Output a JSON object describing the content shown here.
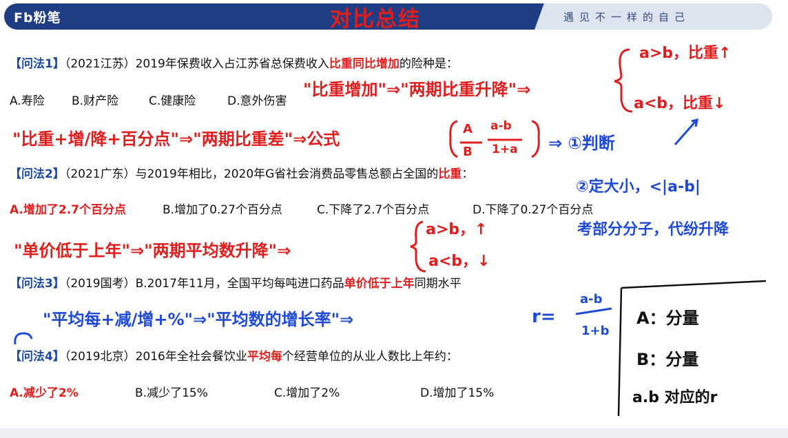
{
  "header": {
    "logo": "Fb粉笔",
    "title": "对比总结",
    "slogan": "遇见不一样的自己"
  },
  "questions": [
    {
      "tag": "【问法1】",
      "source": "（2021江苏）",
      "text_pre": "2019年保费收入占江苏省总保费收入",
      "text_em": "比重同比增加",
      "text_post": "的险种是：",
      "options": [
        "A.寿险",
        "B.财产险",
        "C.健康险",
        "D.意外伤害"
      ]
    },
    {
      "tag": "【问法2】",
      "source": "（2021广东）",
      "text_pre": "与2019年相比，2020年G省社会消费品零售总额占全国的",
      "text_em": "比重",
      "text_post": "：",
      "options": [
        "A.增加了2.7个百分点",
        "B.增加了0.27个百分点",
        "C.下降了2.7个百分点",
        "D.下降了0.27个百分点"
      ]
    },
    {
      "tag": "【问法3】",
      "source": "（2019国考）",
      "text_pre": "B.2017年11月，全国平均每吨进口药品",
      "text_em": "单价低于上年",
      "text_post": "同期水平"
    },
    {
      "tag": "【问法4】",
      "source": "（2019北京）",
      "text_pre": "2016年全社会餐饮业",
      "text_em": "平均每",
      "text_post": "个经营单位的从业人数比上年约：",
      "options": [
        "A.减少了2%",
        "B.减少了15%",
        "C.增加了2%",
        "D.增加了15%"
      ]
    }
  ],
  "annotations": {
    "red_1": "\"比重增加\"⇒\"两期比重升降\"⇒",
    "red_brace_top": "a>b，比重↑",
    "red_brace_bottom": "a<b，比重↓",
    "red_2": "\"比重+增/降+百分点\"⇒\"两期比重差\"⇒公式",
    "red_formula_num1": "A",
    "red_formula_den1": "B",
    "red_formula_num2": "a-b",
    "red_formula_den2": "1+a",
    "blue_1": "⇒ ①判断",
    "blue_2": "②定大小，<|a-b|",
    "blue_3": "考部分分子，代纷升降",
    "red_3": "\"单价低于上年\"⇒\"两期平均数升降\"⇒",
    "red_brace2_top": "a>b，↑",
    "red_brace2_bottom": "a<b，↓",
    "blue_4": "\"平均每+减/增+%\"⇒\"平均数的增长率\"⇒",
    "blue_formula": "r=",
    "blue_formula_num": "a-b",
    "blue_formula_den": "1+b",
    "box_A": "A：分量",
    "box_B": "B：分量",
    "box_ab": "a.b 对应的r"
  }
}
